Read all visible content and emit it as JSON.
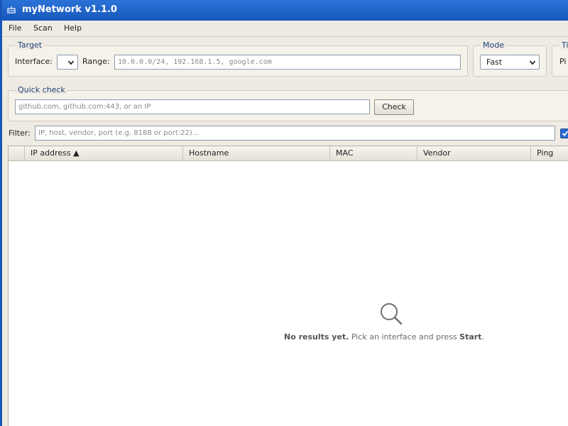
{
  "window": {
    "title": "myNetwork v1.1.0"
  },
  "menu": {
    "file": "File",
    "scan": "Scan",
    "help": "Help"
  },
  "target": {
    "title": "Target",
    "interface_label": "Interface:",
    "range_label": "Range:",
    "range_placeholder": "10.0.0.0/24, 192.168.1.5, google.com"
  },
  "mode": {
    "title": "Mode",
    "selected": "Fast"
  },
  "timing": {
    "title": "Ti",
    "label": "Pi"
  },
  "quick_check": {
    "title": "Quick check",
    "placeholder": "github.com, github.com:443, or an IP",
    "button": "Check"
  },
  "filter": {
    "label": "Filter:",
    "placeholder": "IP, host, vendor, port (e.g. 8188 or port:22)..."
  },
  "table": {
    "columns": [
      "IP address ▲",
      "Hostname",
      "MAC",
      "Vendor",
      "Ping"
    ]
  },
  "empty_state": {
    "bold_lead": "No results yet.",
    "middle": " Pick an interface and press ",
    "bold_action": "Start",
    "end": "."
  }
}
